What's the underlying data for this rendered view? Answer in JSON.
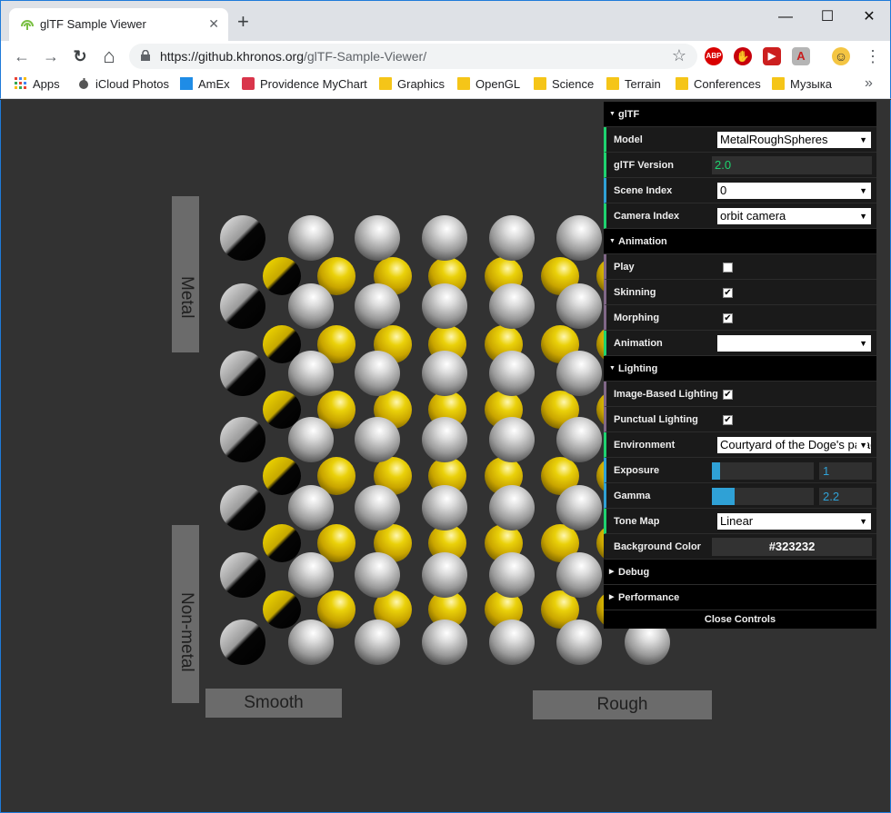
{
  "window": {
    "tab_title": "glTF Sample Viewer",
    "tab_close": "✕",
    "new_tab": "+",
    "minimize": "—",
    "maximize": "☐",
    "close": "✕"
  },
  "toolbar": {
    "back": "←",
    "forward": "→",
    "reload": "↻",
    "home": "⌂",
    "url_host": "https://github.khronos.org",
    "url_path": "/glTF-Sample-Viewer/",
    "star": "☆",
    "menu": "⋮",
    "extensions": [
      {
        "name": "abp",
        "label": "ABP",
        "color": "#d90000"
      },
      {
        "name": "ublock",
        "label": "✋",
        "color": "#c7000b"
      },
      {
        "name": "video",
        "label": "▶",
        "color": "#cc1f1f"
      },
      {
        "name": "pdf",
        "label": "A",
        "color": "#b5b5b5"
      },
      {
        "name": "profile",
        "label": "☺",
        "color": "#f4c542"
      }
    ]
  },
  "bookmarks": {
    "items": [
      {
        "label": "Apps",
        "icon": "apps-grid-icon"
      },
      {
        "label": "iCloud Photos",
        "icon": "apple-icon"
      },
      {
        "label": "AmEx",
        "icon": "amex-icon"
      },
      {
        "label": "Providence MyChart",
        "icon": "mychart-icon"
      },
      {
        "label": "Graphics",
        "icon": "folder-icon"
      },
      {
        "label": "OpenGL",
        "icon": "folder-icon"
      },
      {
        "label": "Science",
        "icon": "folder-icon"
      },
      {
        "label": "Terrain",
        "icon": "folder-icon"
      },
      {
        "label": "Conferences",
        "icon": "folder-icon"
      },
      {
        "label": "Музыка",
        "icon": "folder-icon"
      }
    ],
    "more": "»"
  },
  "scene": {
    "label_metal": "Metal",
    "label_nonmetal": "Non-metal",
    "label_smooth": "Smooth",
    "label_rough": "Rough",
    "background_color": "#323232"
  },
  "gui": {
    "gltf_folder": "glTF",
    "model_label": "Model",
    "model_value": "MetalRoughSpheres",
    "version_label": "glTF Version",
    "version_value": "2.0",
    "scene_index_label": "Scene Index",
    "scene_index_value": "0",
    "camera_index_label": "Camera Index",
    "camera_index_value": "orbit camera",
    "animation_folder": "Animation",
    "play_label": "Play",
    "skinning_label": "Skinning",
    "morphing_label": "Morphing",
    "animation_label": "Animation",
    "animation_value": "",
    "lighting_folder": "Lighting",
    "ibl_label": "Image-Based Lighting",
    "punctual_label": "Punctual Lighting",
    "environment_label": "Environment",
    "environment_value": "Courtyard of the Doge's palace",
    "exposure_label": "Exposure",
    "exposure_value": "1",
    "exposure_fraction": 0.08,
    "gamma_label": "Gamma",
    "gamma_value": "2.2",
    "gamma_fraction": 0.22,
    "tonemap_label": "Tone Map",
    "tonemap_value": "Linear",
    "bgcolor_label": "Background Color",
    "bgcolor_value": "#323232",
    "debug_folder": "Debug",
    "performance_folder": "Performance",
    "close_controls": "Close Controls",
    "check_mark": "✔",
    "arrow_down": "▼",
    "arrow_right": "▶",
    "checks": {
      "play": false,
      "skinning": true,
      "morphing": true,
      "ibl": true,
      "punctual": true
    }
  }
}
